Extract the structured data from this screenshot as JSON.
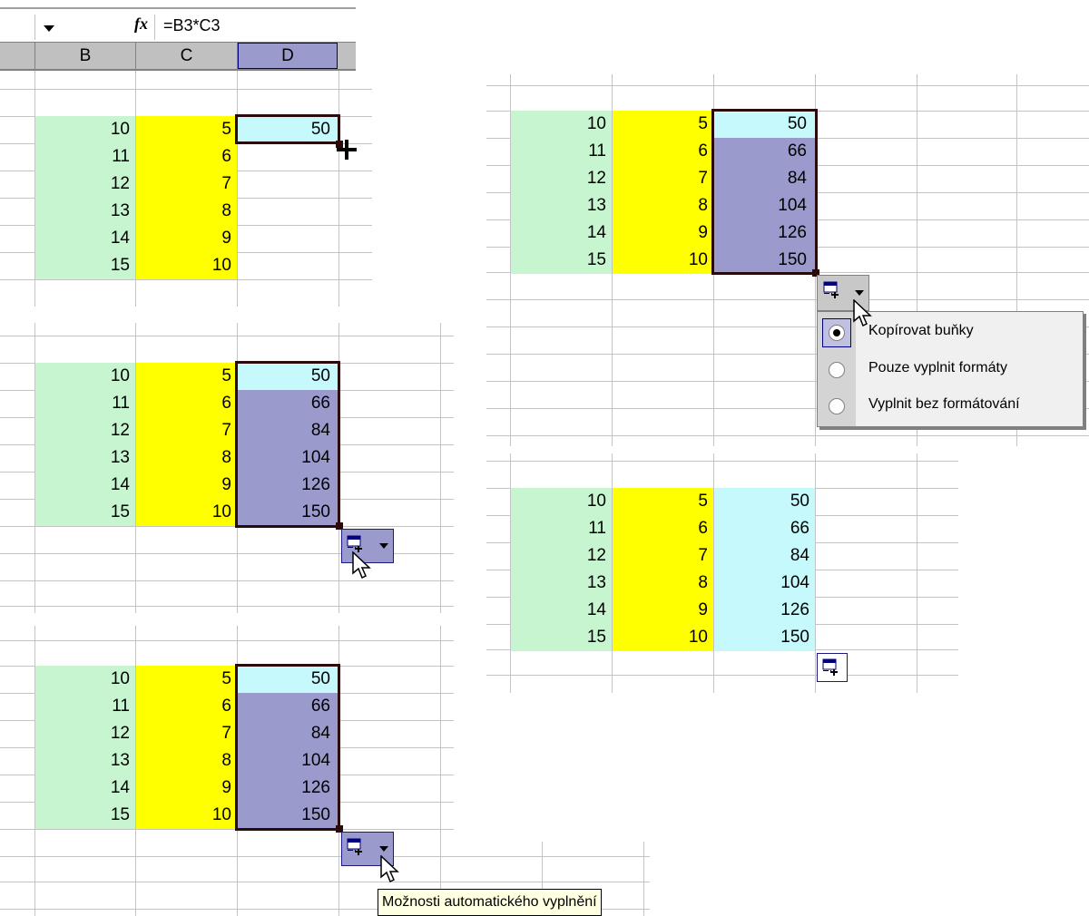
{
  "formula_bar": {
    "name_box_value": "",
    "fx_label": "fx",
    "formula": "=B3*C3"
  },
  "columns": {
    "b": "B",
    "c": "C",
    "d": "D"
  },
  "rows": {
    "b_values": [
      "10",
      "11",
      "12",
      "13",
      "14",
      "15"
    ],
    "c_values": [
      "5",
      "6",
      "7",
      "8",
      "9",
      "10"
    ],
    "d_values": [
      "50",
      "66",
      "84",
      "104",
      "126",
      "150"
    ]
  },
  "step1": {
    "d_first": "50"
  },
  "autofill_menu": {
    "options": [
      "Kopírovat buňky",
      "Pouze vyplnit formáty",
      "Vyplnit bez formátování"
    ],
    "selected_index": 0
  },
  "tooltip": {
    "text": "Možnosti automatického vyplnění"
  },
  "icons": {
    "autofill_options": "autofill-options-icon",
    "dropdown": "chevron-down-icon",
    "fill_cursor": "crosshair-plus-icon",
    "mouse_pointer": "arrow-pointer-icon"
  },
  "colors": {
    "source_b": "#c6f5d0",
    "source_c": "#ffff00",
    "result_first": "#c6f9fc",
    "selection_fill": "#9a9acc",
    "selection_border": "#2a0a0a",
    "tooltip_bg": "#ffffe1",
    "menu_bg": "#f0f0f0"
  }
}
